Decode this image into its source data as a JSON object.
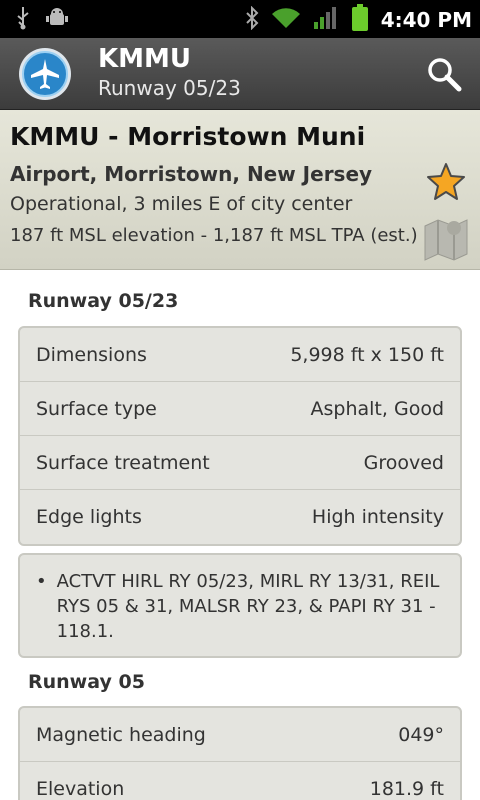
{
  "statusbar": {
    "time": "4:40 PM",
    "icons": [
      "usb-icon",
      "android-debug-icon",
      "bluetooth-icon",
      "wifi-icon",
      "signal-icon",
      "battery-icon"
    ]
  },
  "actionbar": {
    "title": "KMMU",
    "subtitle": "Runway 05/23",
    "app_icon": "airplane-icon",
    "search_icon": "search-icon"
  },
  "header": {
    "name": "KMMU - Morristown Muni",
    "location": "Airport, Morristown, New Jersey",
    "status": "Operational, 3 miles E of city center",
    "elevation": "187 ft MSL elevation - 1,187 ft MSL TPA  (est.)",
    "favorite_icon": "star-icon",
    "map_icon": "map-icon",
    "colors": {
      "star": "#f5a623"
    }
  },
  "runway_section": {
    "title": "Runway 05/23",
    "rows": [
      {
        "label": "Dimensions",
        "value": "5,998 ft x 150 ft"
      },
      {
        "label": "Surface type",
        "value": "Asphalt, Good"
      },
      {
        "label": "Surface treatment",
        "value": "Grooved"
      },
      {
        "label": "Edge lights",
        "value": "High intensity"
      }
    ],
    "remarks": [
      "ACTVT HIRL RY 05/23, MIRL RY 13/31, REIL RYS 05 & 31, MALSR RY 23, &  PAPI RY 31 - 118.1."
    ]
  },
  "runway05_section": {
    "title": "Runway 05",
    "rows": [
      {
        "label": "Magnetic heading",
        "value": "049°"
      },
      {
        "label": "Elevation",
        "value": "181.9 ft"
      }
    ]
  }
}
